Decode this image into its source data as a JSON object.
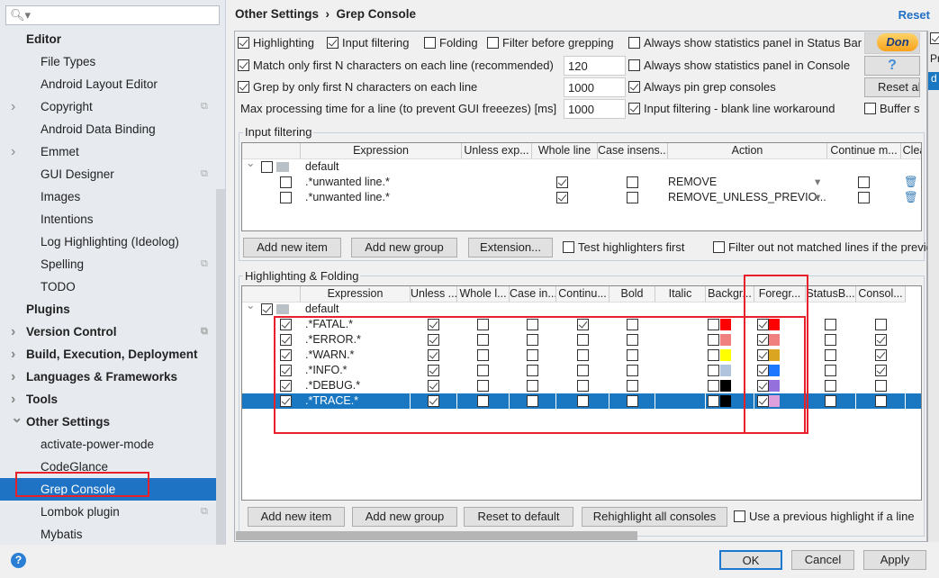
{
  "sidebar": {
    "search_placeholder": "",
    "items": [
      {
        "label": "Editor",
        "level": "head",
        "arrow": "",
        "copy": false
      },
      {
        "label": "File Types",
        "level": "sub",
        "arrow": "",
        "copy": false
      },
      {
        "label": "Android Layout Editor",
        "level": "sub",
        "arrow": "",
        "copy": false
      },
      {
        "label": "Copyright",
        "level": "sub",
        "arrow": "right",
        "copy": true
      },
      {
        "label": "Android Data Binding",
        "level": "sub",
        "arrow": "",
        "copy": false
      },
      {
        "label": "Emmet",
        "level": "sub",
        "arrow": "right",
        "copy": false
      },
      {
        "label": "GUI Designer",
        "level": "sub",
        "arrow": "",
        "copy": true
      },
      {
        "label": "Images",
        "level": "sub",
        "arrow": "",
        "copy": false
      },
      {
        "label": "Intentions",
        "level": "sub",
        "arrow": "",
        "copy": false
      },
      {
        "label": "Log Highlighting (Ideolog)",
        "level": "sub",
        "arrow": "",
        "copy": false
      },
      {
        "label": "Spelling",
        "level": "sub",
        "arrow": "",
        "copy": true
      },
      {
        "label": "TODO",
        "level": "sub",
        "arrow": "",
        "copy": false
      },
      {
        "label": "Plugins",
        "level": "head",
        "arrow": "",
        "copy": false
      },
      {
        "label": "Version Control",
        "level": "head",
        "arrow": "right",
        "copy": true
      },
      {
        "label": "Build, Execution, Deployment",
        "level": "head",
        "arrow": "right",
        "copy": false
      },
      {
        "label": "Languages & Frameworks",
        "level": "head",
        "arrow": "right",
        "copy": false
      },
      {
        "label": "Tools",
        "level": "head",
        "arrow": "right",
        "copy": false
      },
      {
        "label": "Other Settings",
        "level": "head",
        "arrow": "down",
        "copy": false
      },
      {
        "label": "activate-power-mode",
        "level": "sub",
        "arrow": "",
        "copy": false
      },
      {
        "label": "CodeGlance",
        "level": "sub",
        "arrow": "",
        "copy": false
      },
      {
        "label": "Grep Console",
        "level": "sub",
        "arrow": "",
        "copy": false,
        "selected": true
      },
      {
        "label": "Lombok plugin",
        "level": "sub",
        "arrow": "",
        "copy": true
      },
      {
        "label": "Mybatis",
        "level": "sub",
        "arrow": "",
        "copy": false
      }
    ]
  },
  "header": {
    "breadcrumb_parent": "Other Settings",
    "separator": "›",
    "breadcrumb_current": "Grep Console",
    "reset": "Reset"
  },
  "options": {
    "highlighting": {
      "label": "Highlighting",
      "checked": true
    },
    "input_filtering": {
      "label": "Input filtering",
      "checked": true
    },
    "folding": {
      "label": "Folding",
      "checked": false
    },
    "filter_before": {
      "label": "Filter before grepping",
      "checked": false
    },
    "match_first": {
      "label": "Match only first N characters on each line (recommended)",
      "checked": true,
      "value": "120"
    },
    "grep_first": {
      "label": "Grep by only first N characters on each line",
      "checked": true,
      "value": "1000"
    },
    "max_time": {
      "label": "Max processing time for a line (to prevent GUI freeezes) [ms]",
      "value": "1000"
    },
    "stats_statusbar": {
      "label": "Always show statistics panel in Status Bar",
      "checked": false
    },
    "stats_console": {
      "label": "Always show statistics panel in Console",
      "checked": false
    },
    "pin_consoles": {
      "label": "Always pin grep consoles",
      "checked": true
    },
    "blank_line": {
      "label": "Input filtering - blank line workaround",
      "checked": true
    },
    "buffer": {
      "label": "Buffer s",
      "checked": false
    },
    "donate": "Don",
    "help": "?",
    "reset_all": "Reset al"
  },
  "input_filtering": {
    "title": "Input filtering",
    "columns": [
      "Expression",
      "Unless exp...",
      "Whole line",
      "Case insens...",
      "Action",
      "Continue m...",
      "Clea"
    ],
    "group": {
      "label": "default",
      "checked": false
    },
    "rows": [
      {
        "enabled": false,
        "expression": ".*unwanted line.*",
        "whole": true,
        "case": false,
        "action": "REMOVE",
        "continue": false
      },
      {
        "enabled": false,
        "expression": ".*unwanted line.*",
        "whole": true,
        "case": false,
        "action": "REMOVE_UNLESS_PREVIO...",
        "continue": false
      }
    ],
    "buttons": {
      "add_item": "Add new item",
      "add_group": "Add new group",
      "extension": "Extension..."
    },
    "test_first": {
      "label": "Test highlighters first",
      "checked": false
    },
    "filter_out": {
      "label": "Filter out not matched lines if the previo",
      "checked": false
    }
  },
  "highlighting": {
    "title": "Highlighting & Folding",
    "columns": [
      "Expression",
      "Unless ...",
      "Whole l...",
      "Case in...",
      "Continu...",
      "Bold",
      "Italic",
      "Backgr...",
      "Foregr...",
      "StatusB...",
      "Consol..."
    ],
    "group": {
      "label": "default",
      "checked": true
    },
    "rows": [
      {
        "enabled": true,
        "expression": ".*FATAL.*",
        "whole": true,
        "case": false,
        "continue": false,
        "bold": true,
        "italic": false,
        "bg_on": false,
        "bg": "#ff0000",
        "fg_on": true,
        "fg": "#ff0000",
        "statusbar": false,
        "console": false
      },
      {
        "enabled": true,
        "expression": ".*ERROR.*",
        "whole": true,
        "case": false,
        "continue": false,
        "bold": false,
        "italic": false,
        "bg_on": false,
        "bg": "#f08080",
        "fg_on": true,
        "fg": "#f08080",
        "statusbar": false,
        "console": true
      },
      {
        "enabled": true,
        "expression": ".*WARN.*",
        "whole": true,
        "case": false,
        "continue": false,
        "bold": false,
        "italic": false,
        "bg_on": false,
        "bg": "#ffff00",
        "fg_on": true,
        "fg": "#daa520",
        "statusbar": false,
        "console": true
      },
      {
        "enabled": true,
        "expression": ".*INFO.*",
        "whole": true,
        "case": false,
        "continue": false,
        "bold": false,
        "italic": false,
        "bg_on": false,
        "bg": "#b0c4de",
        "fg_on": true,
        "fg": "#1e78ff",
        "statusbar": false,
        "console": true
      },
      {
        "enabled": true,
        "expression": ".*DEBUG.*",
        "whole": true,
        "case": false,
        "continue": false,
        "bold": false,
        "italic": false,
        "bg_on": false,
        "bg": "#000000",
        "fg_on": true,
        "fg": "#9370db",
        "statusbar": false,
        "console": false
      },
      {
        "enabled": true,
        "expression": ".*TRACE.*",
        "whole": true,
        "case": false,
        "continue": false,
        "bold": false,
        "italic": false,
        "bg_on": false,
        "bg": "#000000",
        "fg_on": true,
        "fg": "#dda0dd",
        "statusbar": false,
        "console": false,
        "selected": true
      }
    ],
    "buttons": {
      "add_item": "Add new item",
      "add_group": "Add new group",
      "reset_default": "Reset to default",
      "rehighlight": "Rehighlight all consoles"
    },
    "use_previous": {
      "label": "Use a previous highlight if a line",
      "checked": false
    }
  },
  "footer": {
    "ok": "OK",
    "cancel": "Cancel",
    "apply": "Apply"
  },
  "right_strip": {
    "pr": "Pr",
    "d": "d"
  }
}
